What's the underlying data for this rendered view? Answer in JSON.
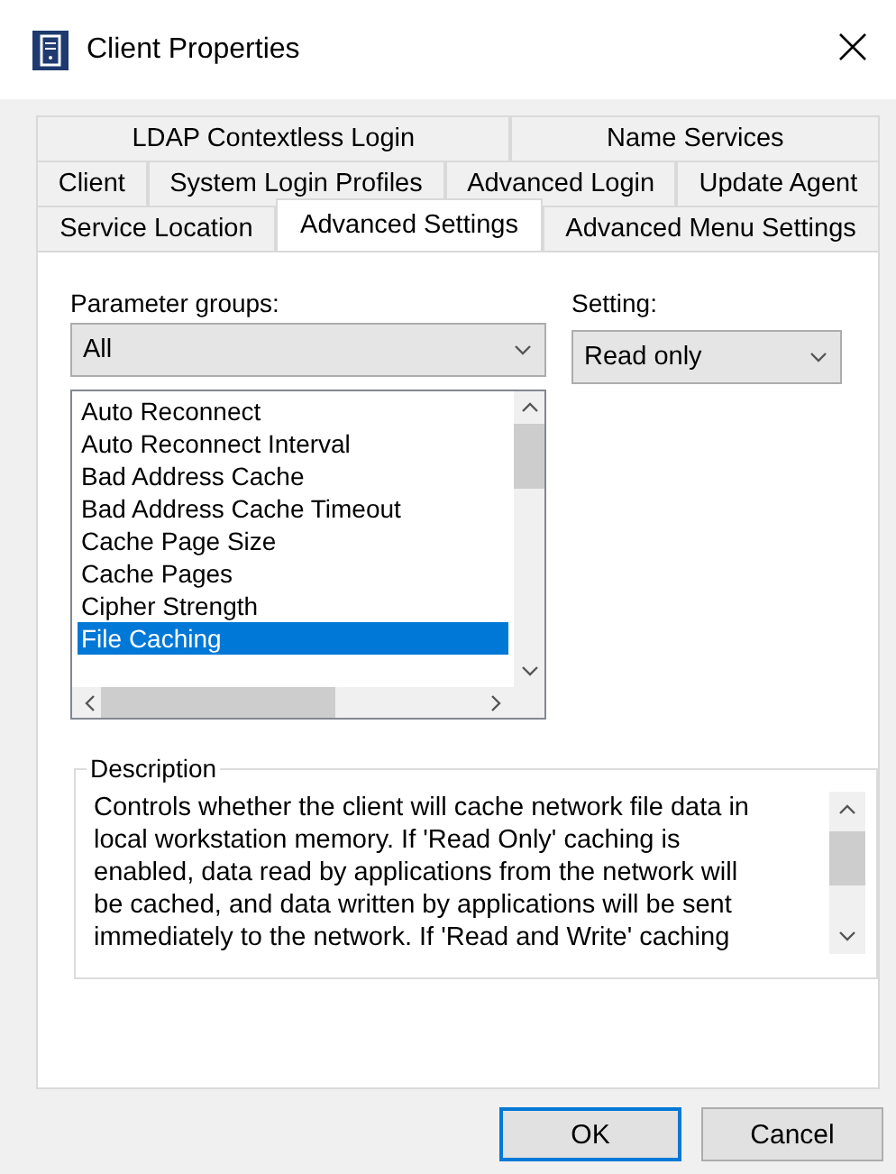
{
  "window": {
    "title": "Client Properties"
  },
  "tab_rows": [
    [
      {
        "label": "LDAP Contextless Login",
        "selected": false
      },
      {
        "label": "Name Services",
        "selected": false
      }
    ],
    [
      {
        "label": "Client",
        "selected": false
      },
      {
        "label": "System Login Profiles",
        "selected": false
      },
      {
        "label": "Advanced Login",
        "selected": false
      },
      {
        "label": "Update Agent",
        "selected": false
      }
    ],
    [
      {
        "label": "Service Location",
        "selected": false
      },
      {
        "label": "Advanced Settings",
        "selected": true
      },
      {
        "label": "Advanced Menu Settings",
        "selected": false
      }
    ]
  ],
  "parameter_groups": {
    "label": "Parameter groups:",
    "value": "All"
  },
  "setting": {
    "label": "Setting:",
    "value": "Read only"
  },
  "parameters": [
    {
      "label": "Auto Reconnect",
      "selected": false
    },
    {
      "label": "Auto Reconnect Interval",
      "selected": false
    },
    {
      "label": "Bad Address Cache",
      "selected": false
    },
    {
      "label": "Bad Address Cache Timeout",
      "selected": false
    },
    {
      "label": "Cache Page Size",
      "selected": false
    },
    {
      "label": "Cache Pages",
      "selected": false
    },
    {
      "label": "Cipher Strength",
      "selected": false
    },
    {
      "label": "File Caching",
      "selected": true
    }
  ],
  "description": {
    "title": "Description",
    "text": "Controls whether the client will cache network file data in local workstation memory.  If 'Read Only' caching is enabled, data read by applications from the network will be cached, and data written by applications will be sent immediately to the network.  If 'Read and Write' caching"
  },
  "buttons": [
    {
      "label": "OK",
      "default": true
    },
    {
      "label": "Cancel",
      "default": false
    }
  ]
}
